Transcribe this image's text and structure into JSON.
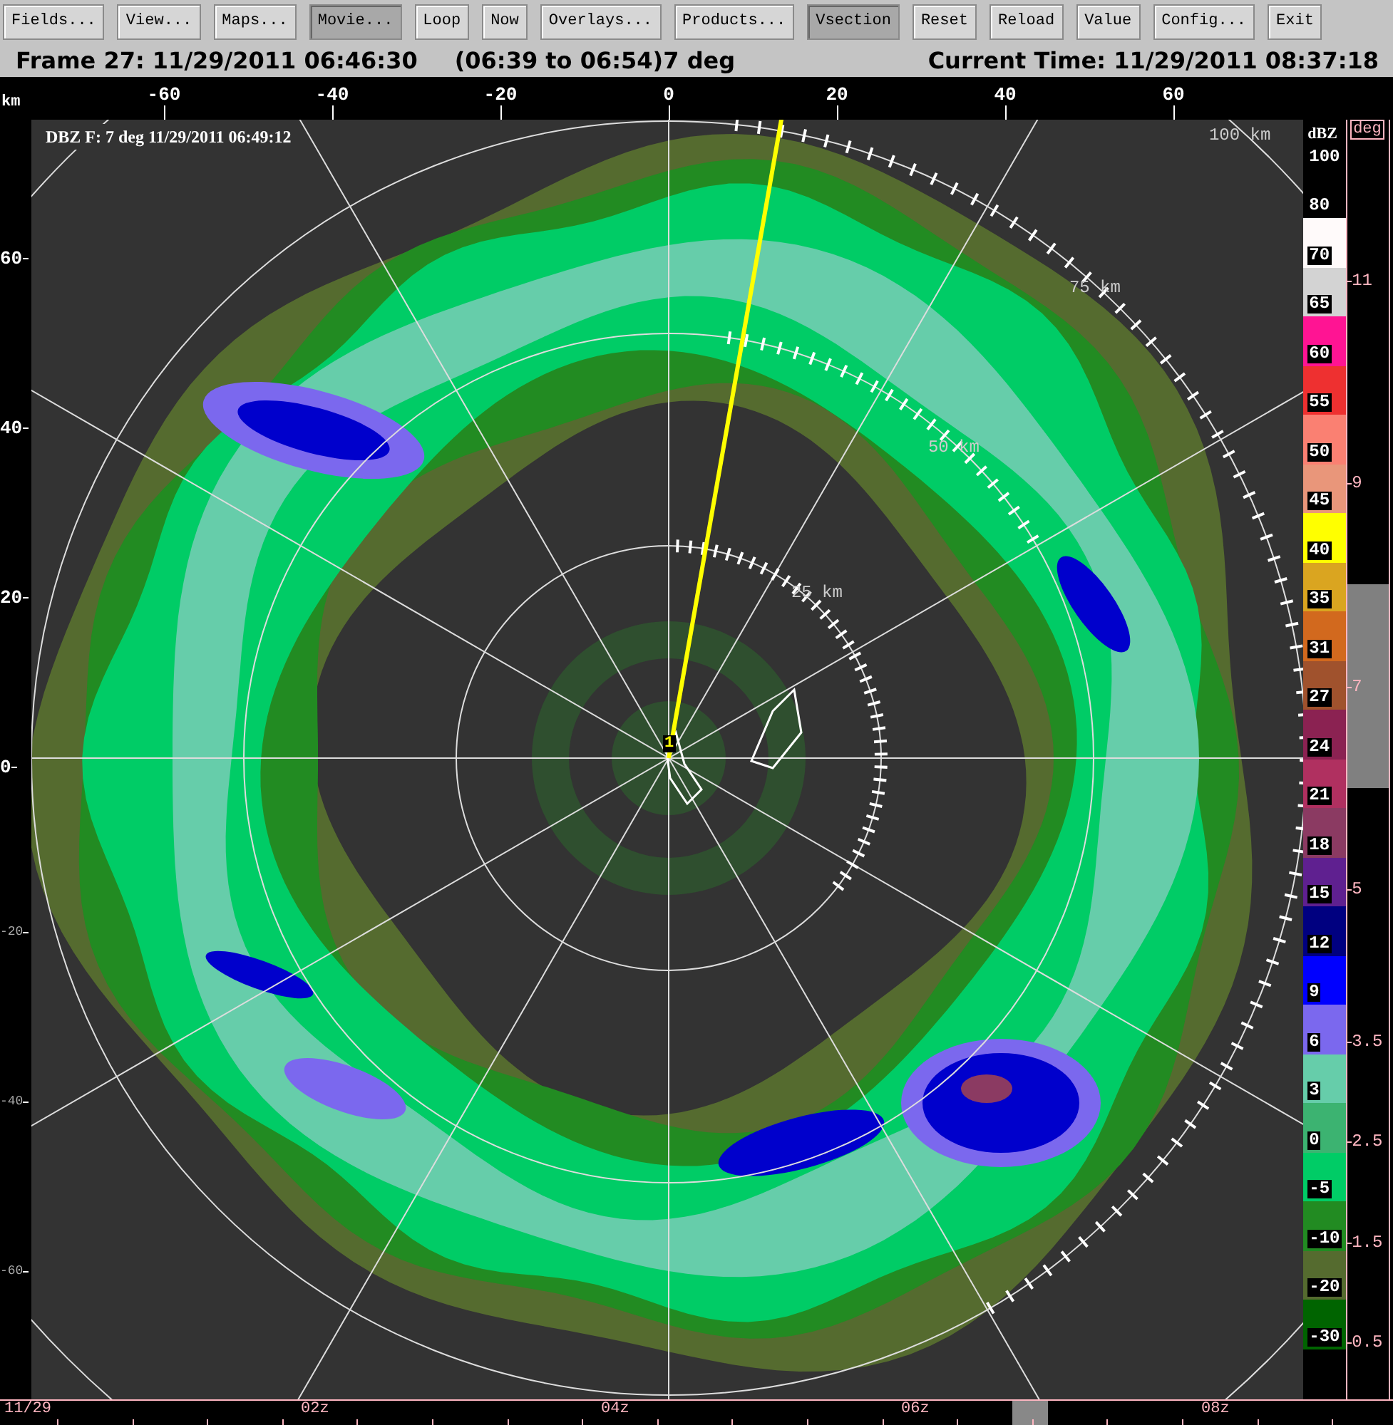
{
  "toolbar": {
    "buttons": [
      {
        "label": "Fields...",
        "selected": false
      },
      {
        "label": "View...",
        "selected": false
      },
      {
        "label": "Maps...",
        "selected": false
      },
      {
        "label": "Movie...",
        "selected": true
      },
      {
        "label": "Loop",
        "selected": false
      },
      {
        "label": "Now",
        "selected": false
      },
      {
        "label": "Overlays...",
        "selected": false
      },
      {
        "label": "Products...",
        "selected": false
      },
      {
        "label": "Vsection",
        "selected": true
      },
      {
        "label": "Reset",
        "selected": false
      },
      {
        "label": "Reload",
        "selected": false
      },
      {
        "label": "Value",
        "selected": false
      },
      {
        "label": "Config...",
        "selected": false
      },
      {
        "label": "Exit",
        "selected": false
      }
    ]
  },
  "header": {
    "frame": "Frame 27: 11/29/2011 06:46:30",
    "range": "(06:39 to 06:54)7 deg",
    "current_time": "Current Time: 11/29/2011 08:37:18"
  },
  "plot": {
    "title": "DBZ F: 7 deg 11/29/2011 06:49:12",
    "x_axis": {
      "unit": "km",
      "ticks": [
        "-60",
        "-40",
        "-20",
        "0",
        "20",
        "40",
        "60"
      ]
    },
    "y_axis": {
      "ticks": [
        {
          "label": "60",
          "faded": false
        },
        {
          "label": "40",
          "faded": false
        },
        {
          "label": "20",
          "faded": false
        },
        {
          "label": "0",
          "faded": false
        },
        {
          "label": "-20",
          "faded": true
        },
        {
          "label": "-40",
          "faded": true
        },
        {
          "label": "-60",
          "faded": true
        }
      ]
    },
    "ring_labels": [
      "25 km",
      "50 km",
      "75 km",
      "100 km"
    ],
    "radar_marker": "1"
  },
  "color_scale": {
    "title": "dBZ",
    "entries": [
      {
        "label": "100",
        "color": "#000000"
      },
      {
        "label": "80",
        "color": "#000000"
      },
      {
        "label": "70",
        "color": "#fffafa"
      },
      {
        "label": "65",
        "color": "#d3d3d3"
      },
      {
        "label": "60",
        "color": "#ff1493"
      },
      {
        "label": "55",
        "color": "#ee3030"
      },
      {
        "label": "50",
        "color": "#fa8072"
      },
      {
        "label": "45",
        "color": "#e9967a"
      },
      {
        "label": "40",
        "color": "#ffff00"
      },
      {
        "label": "35",
        "color": "#daa520"
      },
      {
        "label": "31",
        "color": "#d2691e"
      },
      {
        "label": "27",
        "color": "#a0522d"
      },
      {
        "label": "24",
        "color": "#8b2252"
      },
      {
        "label": "21",
        "color": "#b03060"
      },
      {
        "label": "18",
        "color": "#8b3a62"
      },
      {
        "label": "15",
        "color": "#5f2090"
      },
      {
        "label": "12",
        "color": "#000080"
      },
      {
        "label": "9",
        "color": "#0000ff"
      },
      {
        "label": "6",
        "color": "#7b68ee"
      },
      {
        "label": "3",
        "color": "#66cdaa"
      },
      {
        "label": "0",
        "color": "#3cb371"
      },
      {
        "label": "-5",
        "color": "#00cc66"
      },
      {
        "label": "-10",
        "color": "#228b22"
      },
      {
        "label": "-20",
        "color": "#556b2f"
      },
      {
        "label": "-30",
        "color": "#006400"
      }
    ]
  },
  "elevation_scale": {
    "title": "deg",
    "ticks": [
      {
        "label": "11",
        "selected": false
      },
      {
        "label": "9",
        "selected": false
      },
      {
        "label": "7",
        "selected": true
      },
      {
        "label": "5",
        "selected": false
      },
      {
        "label": "3.5",
        "selected": false
      },
      {
        "label": "2.5",
        "selected": false
      },
      {
        "label": "1.5",
        "selected": false
      },
      {
        "label": "0.5",
        "selected": false
      }
    ]
  },
  "time_axis": {
    "date": "11/29",
    "ticks": [
      "02z",
      "04z",
      "06z",
      "08z"
    ],
    "level": 0.727
  }
}
